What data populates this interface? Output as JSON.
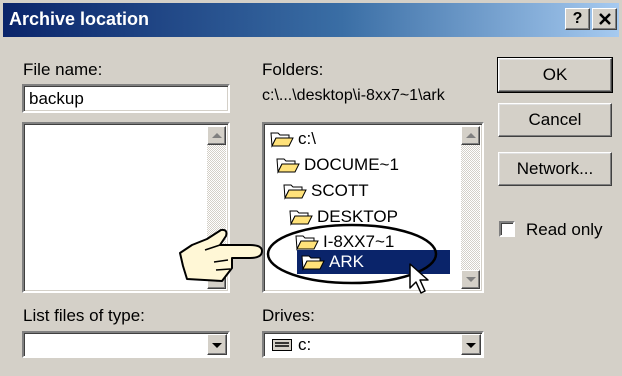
{
  "window": {
    "title": "Archive location",
    "help_label": "?",
    "close_label": "✕"
  },
  "file_name": {
    "label": "File name:",
    "value": "backup"
  },
  "folders": {
    "label": "Folders:",
    "current_path": "c:\\...\\desktop\\i-8xx7~1\\ark",
    "items": [
      {
        "label": "c:\\",
        "icon": "open-folder-icon"
      },
      {
        "label": "DOCUME~1",
        "icon": "open-folder-icon"
      },
      {
        "label": "SCOTT",
        "icon": "open-folder-icon"
      },
      {
        "label": "DESKTOP",
        "icon": "open-folder-icon"
      },
      {
        "label": "I-8XX7~1",
        "icon": "open-folder-icon"
      },
      {
        "label": "ARK",
        "icon": "open-folder-icon",
        "selected": true
      }
    ]
  },
  "list_files_of_type": {
    "label": "List files of type:",
    "value": ""
  },
  "drives": {
    "label": "Drives:",
    "value": "c:",
    "icon": "drive-icon"
  },
  "buttons": {
    "ok": "OK",
    "cancel": "Cancel",
    "network": "Network..."
  },
  "read_only": {
    "label": "Read only",
    "checked": false
  },
  "annotations": [
    "pointing-hand-icon",
    "highlight-ellipse",
    "mouse-cursor-icon"
  ]
}
